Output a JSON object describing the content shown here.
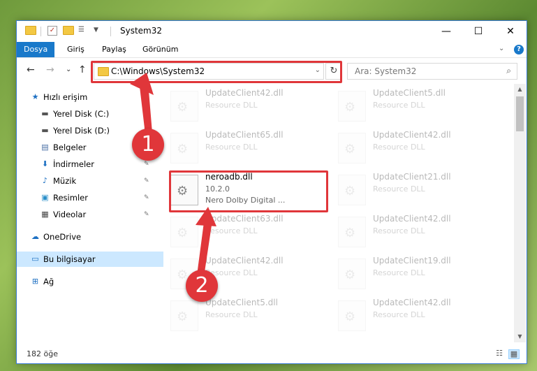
{
  "window": {
    "title": "System32",
    "controls": {
      "minimize": "—",
      "maximize": "☐",
      "close": "✕"
    }
  },
  "ribbon": {
    "tabs": [
      "Dosya",
      "Giriş",
      "Paylaş",
      "Görünüm"
    ],
    "active": "Dosya",
    "help": "?"
  },
  "nav": {
    "back": "←",
    "forward": "→",
    "recent": "⌄",
    "up": "↑",
    "address": "C:\\Windows\\System32",
    "search_placeholder": "Ara: System32"
  },
  "sidebar": {
    "items": [
      {
        "label": "Hızlı erişim",
        "icon": "star-icon",
        "glyph": "★",
        "color": "#1c6fc2",
        "pinned": false
      },
      {
        "label": "Yerel Disk (C:)",
        "icon": "drive-icon",
        "glyph": "▬",
        "color": "#555555",
        "pinned": true
      },
      {
        "label": "Yerel Disk (D:)",
        "icon": "drive-icon",
        "glyph": "▬",
        "color": "#555555",
        "pinned": true
      },
      {
        "label": "Belgeler",
        "icon": "document-icon",
        "glyph": "▤",
        "color": "#4a6fa5",
        "pinned": true
      },
      {
        "label": "İndirmeler",
        "icon": "download-icon",
        "glyph": "⬇",
        "color": "#1c6fc2",
        "pinned": true
      },
      {
        "label": "Müzik",
        "icon": "music-icon",
        "glyph": "♪",
        "color": "#1c6fc2",
        "pinned": true
      },
      {
        "label": "Resimler",
        "icon": "picture-icon",
        "glyph": "▣",
        "color": "#2a8fc9",
        "pinned": true
      },
      {
        "label": "Videolar",
        "icon": "video-icon",
        "glyph": "▦",
        "color": "#444444",
        "pinned": true
      },
      {
        "label": "OneDrive",
        "icon": "cloud-icon",
        "glyph": "☁",
        "color": "#1c6fc2",
        "pinned": false
      },
      {
        "label": "Bu bilgisayar",
        "icon": "computer-icon",
        "glyph": "▭",
        "color": "#1c6fc2",
        "pinned": false,
        "selected": true
      },
      {
        "label": "Ağ",
        "icon": "network-icon",
        "glyph": "⊞",
        "color": "#1c6fc2",
        "pinned": false
      }
    ]
  },
  "files": {
    "left_column": [
      {
        "name": "UpdateClient42.dll",
        "type": "Resource DLL"
      },
      {
        "name": "UpdateClient65.dll",
        "type": "Resource DLL"
      },
      {
        "name": "neroadb.dll",
        "version": "10.2.0",
        "description": "Nero Dolby Digital ...",
        "highlighted": true
      },
      {
        "name": "UpdateClient63.dll",
        "type": "Resource DLL"
      },
      {
        "name": "UpdateClient42.dll",
        "type": "Resource DLL"
      },
      {
        "name": "UpdateClient5.dll",
        "type": "Resource DLL"
      }
    ],
    "right_column": [
      {
        "name": "UpdateClient5.dll",
        "type": "Resource DLL"
      },
      {
        "name": "UpdateClient42.dll",
        "type": "Resource DLL"
      },
      {
        "name": "UpdateClient21.dll",
        "type": "Resource DLL"
      },
      {
        "name": "UpdateClient42.dll",
        "type": "Resource DLL"
      },
      {
        "name": "UpdateClient19.dll",
        "type": "Resource DLL"
      },
      {
        "name": "UpdateClient42.dll",
        "type": "Resource DLL"
      }
    ]
  },
  "status": {
    "count": "182 öğe"
  },
  "annotations": {
    "marker1": "1",
    "marker2": "2",
    "color": "#e0363a"
  }
}
